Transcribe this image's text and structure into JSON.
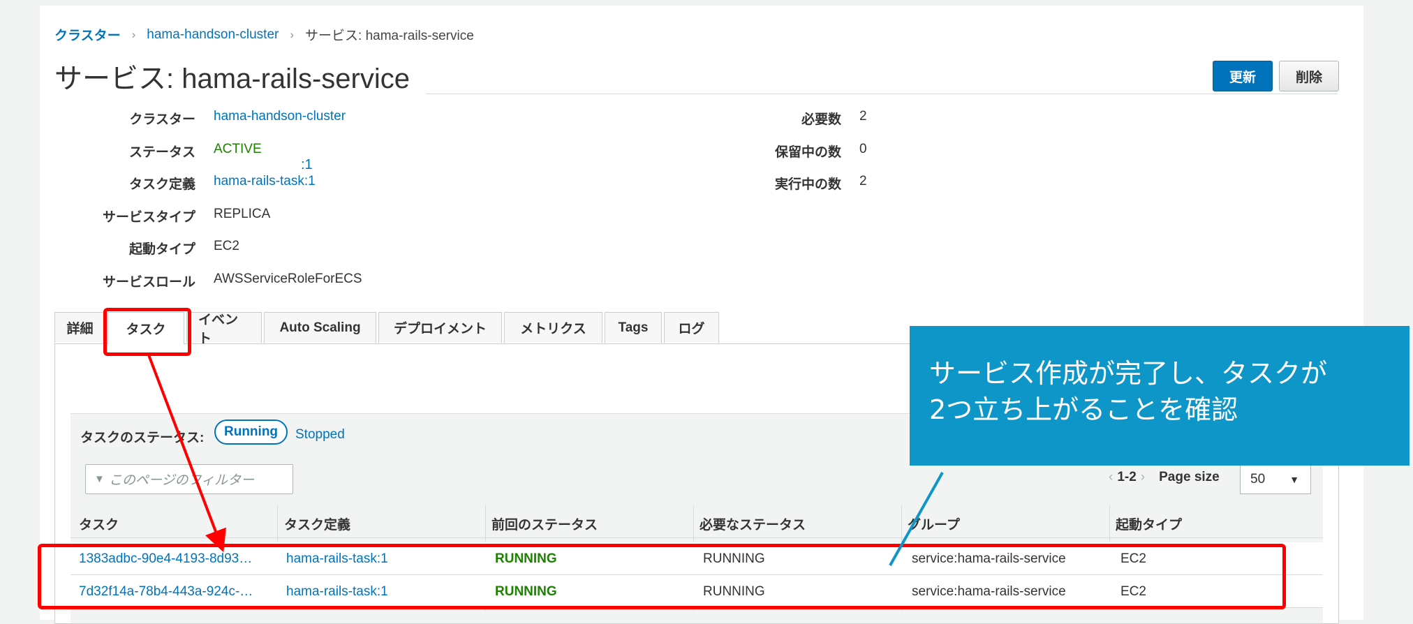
{
  "breadcrumb": {
    "root": "クラスター",
    "cluster": "hama-handson-cluster",
    "current": "サービス: hama-rails-service"
  },
  "title": "サービス: hama-rails-service",
  "buttons": {
    "update": "更新",
    "delete": "削除"
  },
  "details_left": [
    {
      "label": "クラスター",
      "value": "hama-handson-cluster",
      "style": "link"
    },
    {
      "label": "ステータス",
      "value": "ACTIVE",
      "style": "active"
    },
    {
      "label": "タスク定義",
      "value": "hama-rails-task:1",
      "style": "link"
    },
    {
      "label": "サービスタイプ",
      "value": "REPLICA",
      "style": "plain"
    },
    {
      "label": "起動タイプ",
      "value": "EC2",
      "style": "plain"
    },
    {
      "label": "サービスロール",
      "value": "AWSServiceRoleForECS",
      "style": "plain"
    }
  ],
  "overlay_tag": ":1",
  "details_right": [
    {
      "label": "必要数",
      "value": "2"
    },
    {
      "label": "保留中の数",
      "value": "0"
    },
    {
      "label": "実行中の数",
      "value": "2"
    }
  ],
  "tabs": [
    {
      "label": "詳細",
      "active": false
    },
    {
      "label": "タスク",
      "active": true
    },
    {
      "label": "イベント",
      "active": false
    },
    {
      "label": "Auto Scaling",
      "active": false
    },
    {
      "label": "デプロイメント",
      "active": false
    },
    {
      "label": "メトリクス",
      "active": false
    },
    {
      "label": "Tags",
      "active": false
    },
    {
      "label": "ログ",
      "active": false
    }
  ],
  "task_status": {
    "label": "タスクのステータス:",
    "running": "Running",
    "stopped": "Stopped"
  },
  "filter": {
    "placeholder": "このページのフィルター"
  },
  "pagination": {
    "range": "1-2",
    "page_size_label": "Page size",
    "page_size": "50"
  },
  "table": {
    "columns": [
      "タスク",
      "タスク定義",
      "前回のステータス",
      "必要なステータス",
      "グループ",
      "起動タイプ"
    ],
    "rows": [
      [
        "1383adbc-90e4-4193-8d93…",
        "hama-rails-task:1",
        "RUNNING",
        "RUNNING",
        "service:hama-rails-service",
        "EC2"
      ],
      [
        "7d32f14a-78b4-443a-924c-…",
        "hama-rails-task:1",
        "RUNNING",
        "RUNNING",
        "service:hama-rails-service",
        "EC2"
      ]
    ]
  },
  "callout": {
    "line1": "サービス作成が完了し、タスクが",
    "line2": "2つ立ち上がることを確認"
  },
  "colors": {
    "link": "#0073bb",
    "active": "#1d8102",
    "highlight": "#ff0000",
    "callout": "#0e96c8"
  }
}
